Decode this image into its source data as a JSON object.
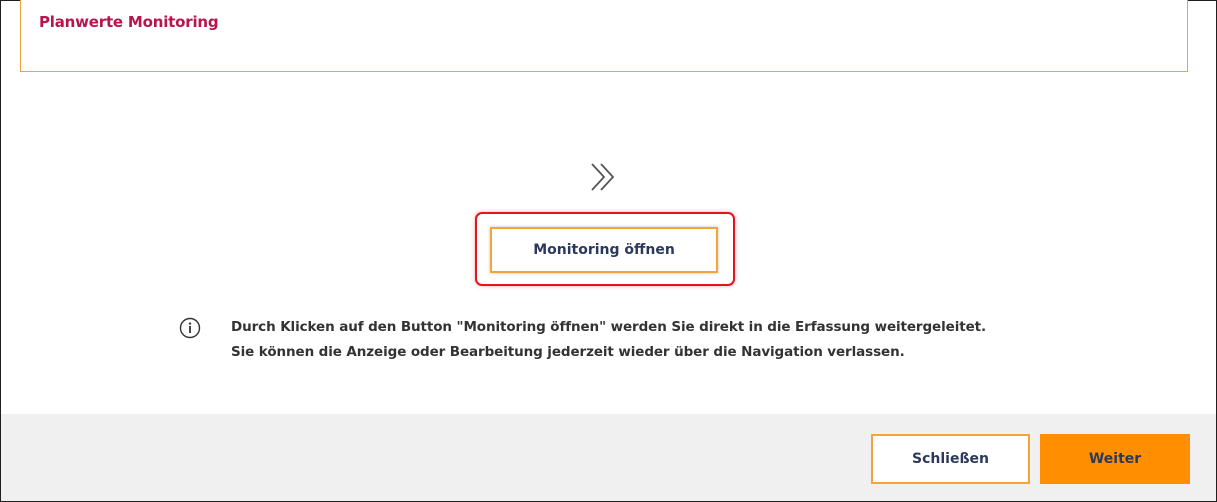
{
  "header": {
    "title": "Planwerte Monitoring"
  },
  "main": {
    "chevron_icon": "double-chevron-right-icon",
    "monitoring_button_label": "Monitoring öffnen",
    "info_icon": "info-circle-icon",
    "info_line_1": "Durch Klicken auf den Button \"Monitoring öffnen\" werden Sie direkt in die Erfassung weitergeleitet.",
    "info_line_2": "Sie können die Anzeige oder Bearbeitung jederzeit wieder über die Navigation verlassen."
  },
  "footer": {
    "close_label": "Schließen",
    "next_label": "Weiter"
  },
  "colors": {
    "accent_orange": "#ff8f00",
    "border_orange": "#f3a53a",
    "title_magenta": "#b8154d",
    "highlight_red": "#e3141c",
    "button_text": "#2b3a5c",
    "footer_bg": "#f0f0f0"
  }
}
